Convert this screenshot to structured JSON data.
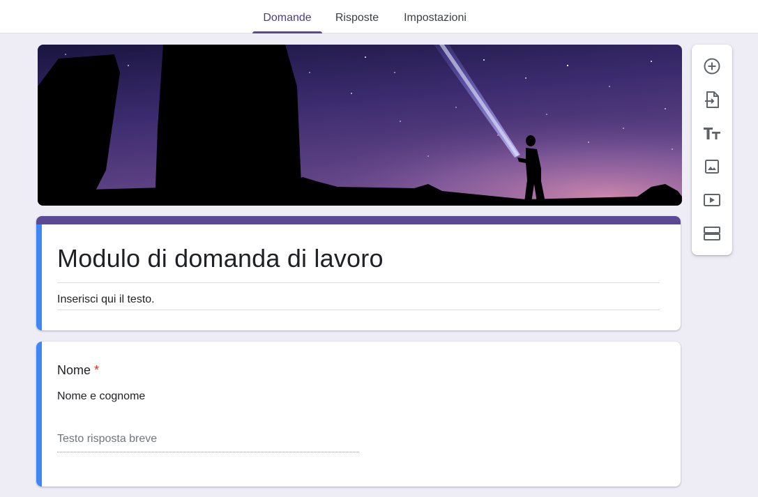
{
  "tabs": [
    {
      "label": "Domande",
      "active": true
    },
    {
      "label": "Risposte",
      "active": false
    },
    {
      "label": "Impostazioni",
      "active": false
    }
  ],
  "form": {
    "title": "Modulo di domanda di lavoro",
    "description": "Inserisci qui il testo."
  },
  "question": {
    "title": "Nome",
    "required_mark": "*",
    "description": "Nome e cognome",
    "answer_placeholder": "Testo risposta breve"
  },
  "toolbar": {
    "items": [
      {
        "icon": "add-circle-icon"
      },
      {
        "icon": "import-questions-icon"
      },
      {
        "icon": "title-text-icon"
      },
      {
        "icon": "image-icon"
      },
      {
        "icon": "video-icon"
      },
      {
        "icon": "section-icon"
      }
    ]
  },
  "colors": {
    "theme": "#5b4a93",
    "accent_blue": "#4285f4",
    "required": "#d93025",
    "background": "#eeedf5"
  }
}
